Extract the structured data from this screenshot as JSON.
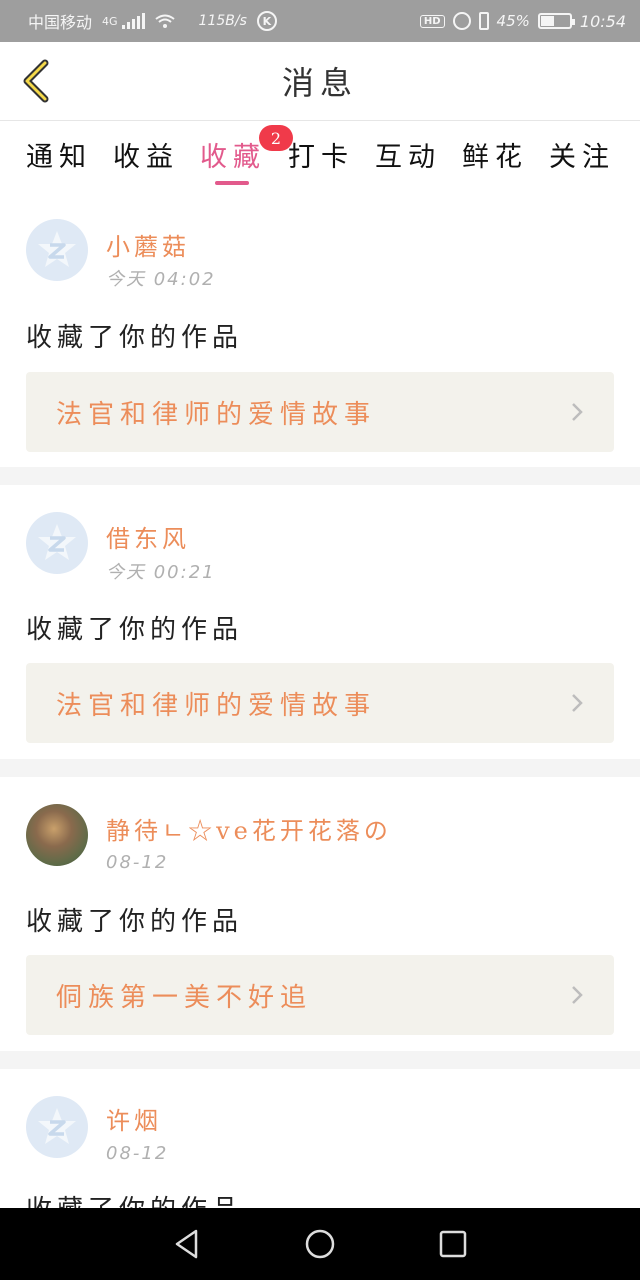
{
  "status_bar": {
    "carrier": "中国移动",
    "network": "4G",
    "speed": "115B/s",
    "hd": "HD",
    "battery": "45%",
    "time": "10:54"
  },
  "header": {
    "title": "消息"
  },
  "tabs": [
    {
      "label": "通知"
    },
    {
      "label": "收益"
    },
    {
      "label": "收藏",
      "badge": "2"
    },
    {
      "label": "打卡"
    },
    {
      "label": "互动"
    },
    {
      "label": "鲜花"
    },
    {
      "label": "关注"
    }
  ],
  "messages": [
    {
      "user": "小蘑菇",
      "time": "今天 04:02",
      "action": "收藏了你的作品",
      "work": "法官和律师的爱情故事"
    },
    {
      "user": "借东风",
      "time": "今天 00:21",
      "action": "收藏了你的作品",
      "work": "法官和律师的爱情故事"
    },
    {
      "user": "静待ㄴ☆ve花开花落の",
      "time": "08-12",
      "action": "收藏了你的作品",
      "work": "侗族第一美不好追"
    },
    {
      "user": "许烟",
      "time": "08-12",
      "action": "收藏了你的作品"
    }
  ],
  "icons": {
    "back": "chevron-left-icon",
    "avatar_default": "qq-avatar-icon",
    "item_arrow": "chevron-right-icon",
    "nav_back": "triangle-back-icon",
    "nav_home": "circle-home-icon",
    "nav_recent": "square-recent-icon"
  },
  "colors": {
    "accent": "#e25a8c",
    "name": "#ec8d5a",
    "badge": "#f03a4a",
    "work_bg": "#f3f2ec"
  }
}
